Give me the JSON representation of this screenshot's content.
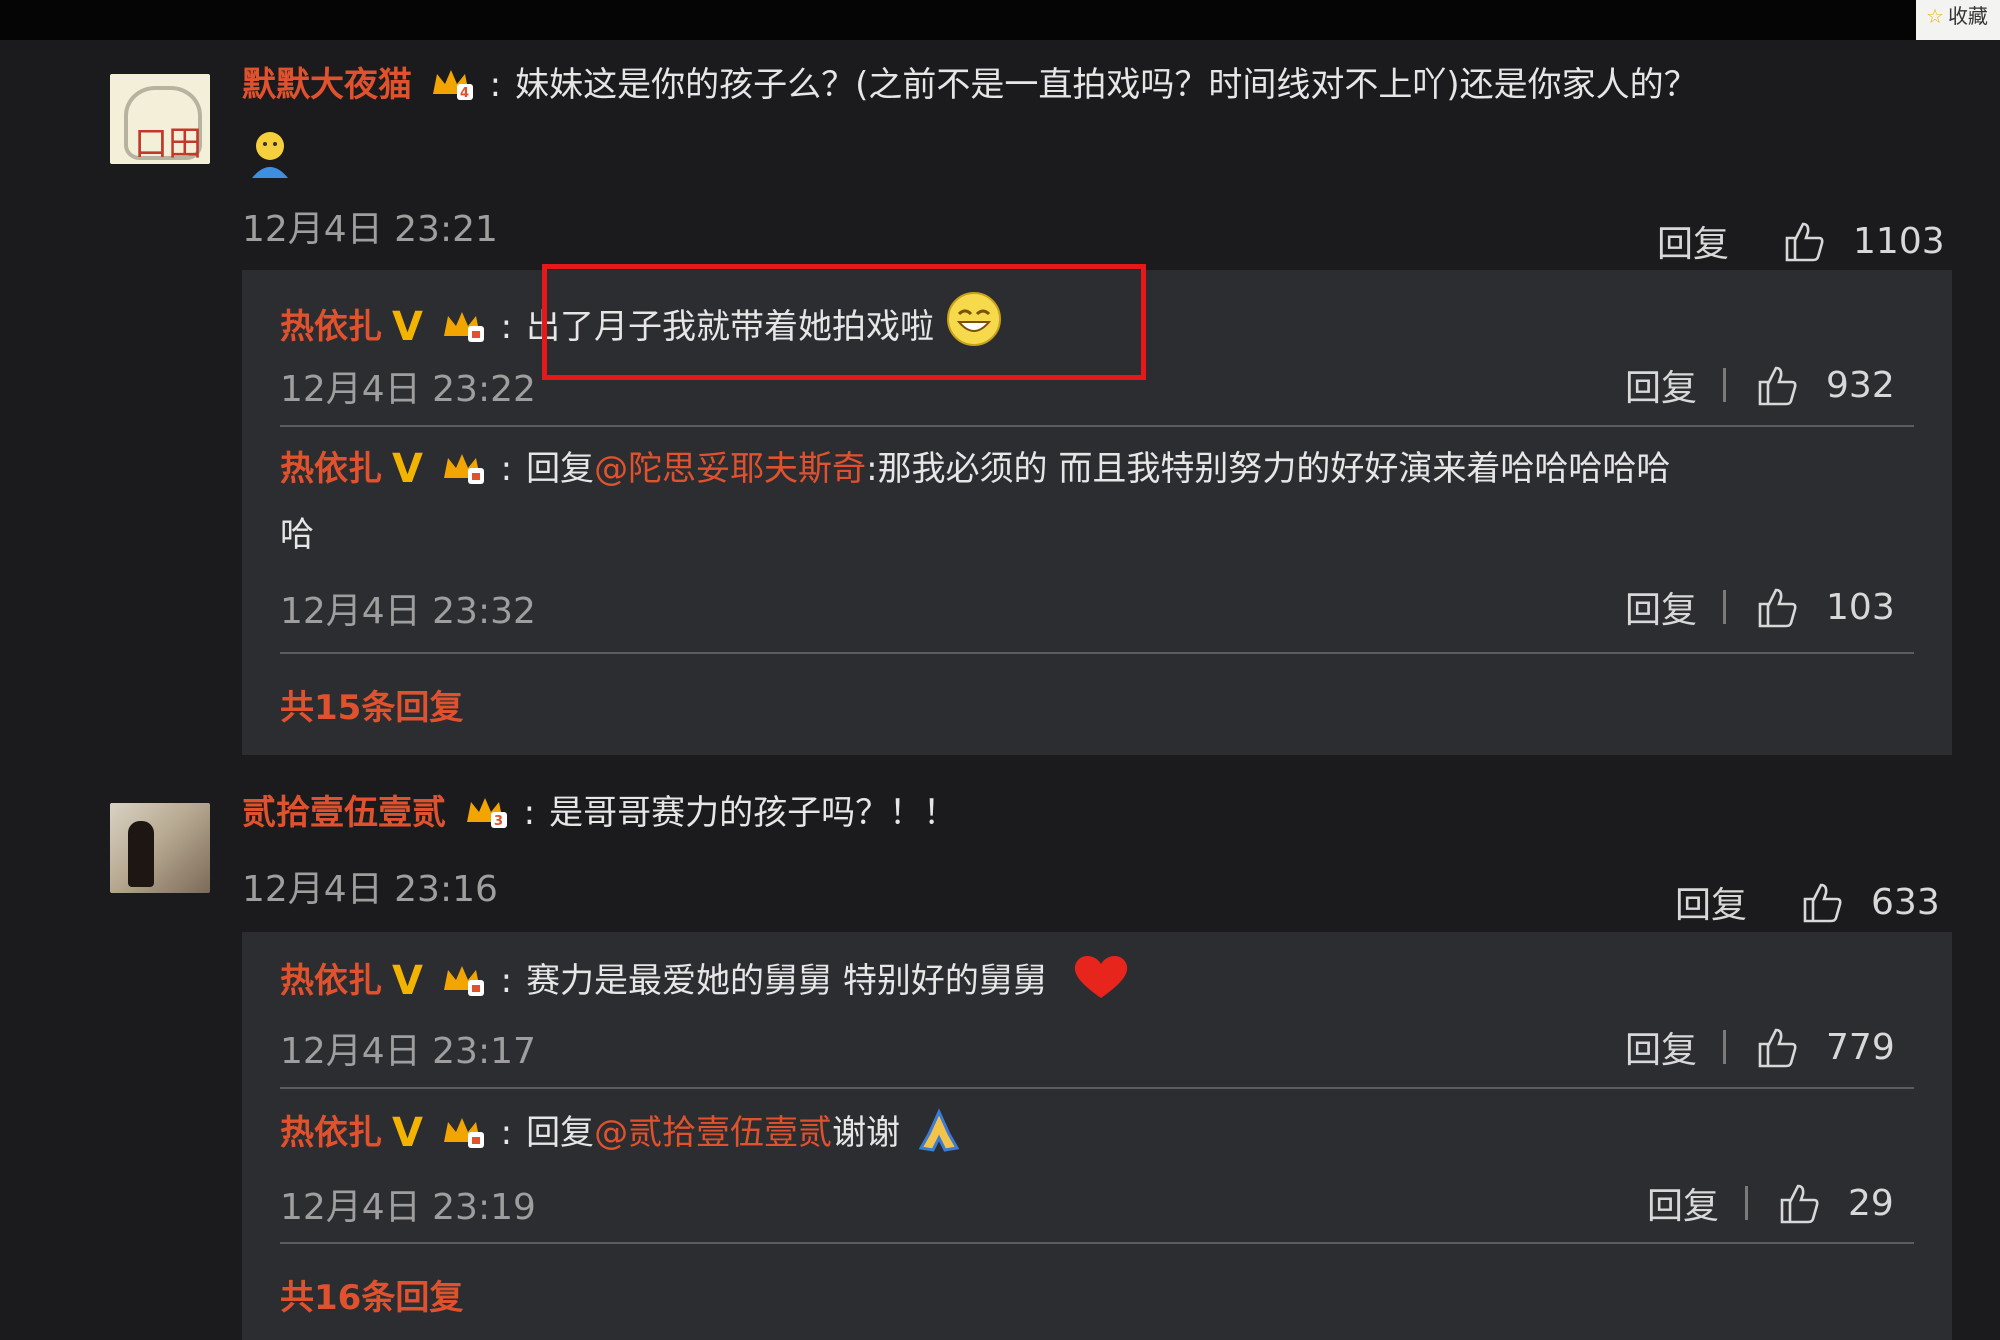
{
  "window": {
    "bookmark_label": "收藏"
  },
  "comments": [
    {
      "username": "默默大夜猫",
      "text": "妹妹这是你的孩子么？(之前不是一直拍戏吗？时间线对不上吖)还是你家人的？",
      "emoji": "person-emoji",
      "timestamp": "12月4日 23:21",
      "reply_label": "回复",
      "likes": "1103",
      "replies": [
        {
          "username": "热依扎",
          "verified": "V",
          "text": "出了月子我就带着她拍戏啦",
          "emoji": "grin-emoji",
          "timestamp": "12月4日 23:22",
          "reply_label": "回复",
          "likes": "932",
          "highlighted": true
        },
        {
          "username": "热依扎",
          "verified": "V",
          "reply_prefix": "回复",
          "mention": "@陀思妥耶夫斯奇",
          "text": ":那我必须的 而且我特别努力的好好演来着哈哈哈哈哈",
          "text_wrap": "哈",
          "timestamp": "12月4日 23:32",
          "reply_label": "回复",
          "likes": "103"
        }
      ],
      "total_replies": "共15条回复"
    },
    {
      "username": "贰拾壹伍壹贰",
      "text": "是哥哥赛力的孩子吗？！！",
      "timestamp": "12月4日 23:16",
      "reply_label": "回复",
      "likes": "633",
      "replies": [
        {
          "username": "热依扎",
          "verified": "V",
          "text": "赛力是最爱她的舅舅 特别好的舅舅",
          "emoji": "heart-emoji",
          "timestamp": "12月4日 23:17",
          "reply_label": "回复",
          "likes": "779"
        },
        {
          "username": "热依扎",
          "verified": "V",
          "reply_prefix": "回复",
          "mention": "@贰拾壹伍壹贰",
          "text": "谢谢",
          "emoji": "pray-emoji",
          "timestamp": "12月4日 23:19",
          "reply_label": "回复",
          "likes": "29"
        }
      ],
      "total_replies": "共16条回复"
    }
  ],
  "colors": {
    "accent": "#e0522d",
    "highlight": "#e8171a",
    "verified": "#f2b400",
    "background": "#1b1b1d",
    "reply_box": "#2c2d31"
  }
}
